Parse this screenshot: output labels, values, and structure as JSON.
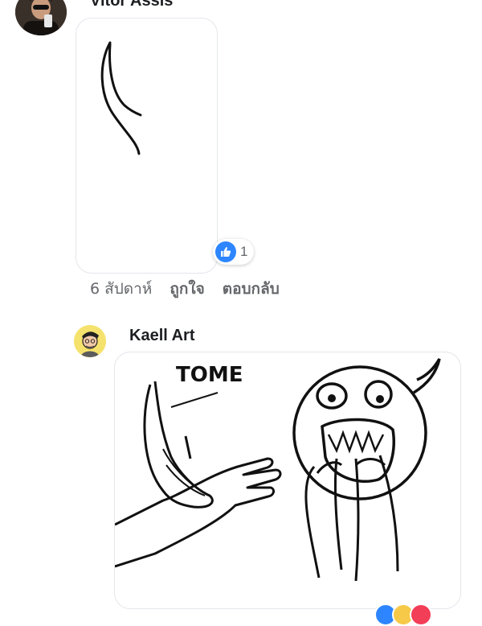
{
  "comments": [
    {
      "author": "Vitor Assis",
      "reaction_count": "1",
      "timestamp": "6 สัปดาห์",
      "like_action": "ถูกใจ",
      "reply_action": "ตอบกลับ"
    },
    {
      "author": "Kaell Art",
      "drawing_text": "TOME"
    }
  ],
  "colors": {
    "like_blue": "#2d86ff",
    "meta_gray": "#65676b",
    "border_gray": "#e4e6eb"
  }
}
